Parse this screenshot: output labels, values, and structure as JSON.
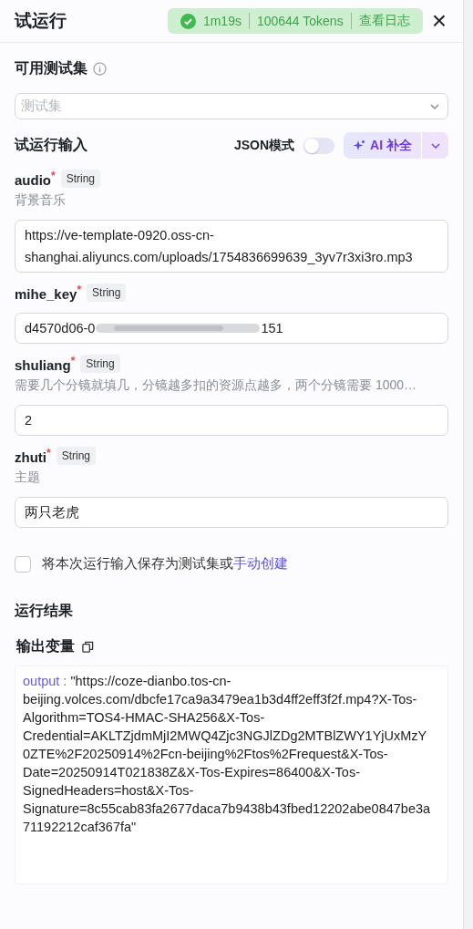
{
  "header": {
    "title": "试运行",
    "status": {
      "duration": "1m19s",
      "tokens": "100644 Tokens",
      "log_link": "查看日志"
    },
    "close": "×"
  },
  "test_set": {
    "label": "可用测试集",
    "placeholder": "测试集"
  },
  "inputs_section": {
    "title": "试运行输入",
    "json_mode": {
      "label": "JSON模式",
      "on": false
    },
    "ai_button": "AI 补全"
  },
  "fields": [
    {
      "kind": "text",
      "name": "audio",
      "required_mark": "*",
      "type": "String",
      "description": "背景音乐",
      "value": "https://ve-template-0920.oss-cn-shanghai.aliyuncs.com/uploads/1754836699639_3yv7r3xi3ro.mp3"
    },
    {
      "kind": "redacted",
      "name": "mihe_key",
      "required_mark": "*",
      "type": "String",
      "value": "d4570d06-0",
      "value_end": "151"
    },
    {
      "kind": "text",
      "name": "shuliang",
      "required_mark": "*",
      "type": "String",
      "description": "需要几个分镜就填几，分镜越多扣的资源点越多，两个分镜需要 1000…",
      "value": "2"
    },
    {
      "kind": "text",
      "name": "zhuti",
      "required_mark": "*",
      "type": "String",
      "description": "主题",
      "value": "两只老虎"
    }
  ],
  "save_option": {
    "checked": false,
    "text": "将本次运行输入保存为测试集或",
    "link": "手动创建"
  },
  "result": {
    "title": "运行结果",
    "output_label": "输出变量",
    "key": "output :",
    "value": "\"https://coze-dianbo.tos-cn-beijing.volces.com/dbcfe17ca9a3479ea1b3d4ff2eff3f2f.mp4?X-Tos-Algorithm=TOS4-HMAC-SHA256&X-Tos-Credential=AKLTZjdmMjI2MWQ4Zjc3NGJlZDg2MTBlZWY1YjUxMzY0ZTE%2F20250914%2Fcn-beijing%2Ftos%2Frequest&X-Tos-Date=20250914T021838Z&X-Tos-Expires=86400&X-Tos-SignedHeaders=host&X-Tos-Signature=8c55cab83fa2677daca7b9438b43fbed12202abe0847be3a71192212caf367fa\""
  }
}
